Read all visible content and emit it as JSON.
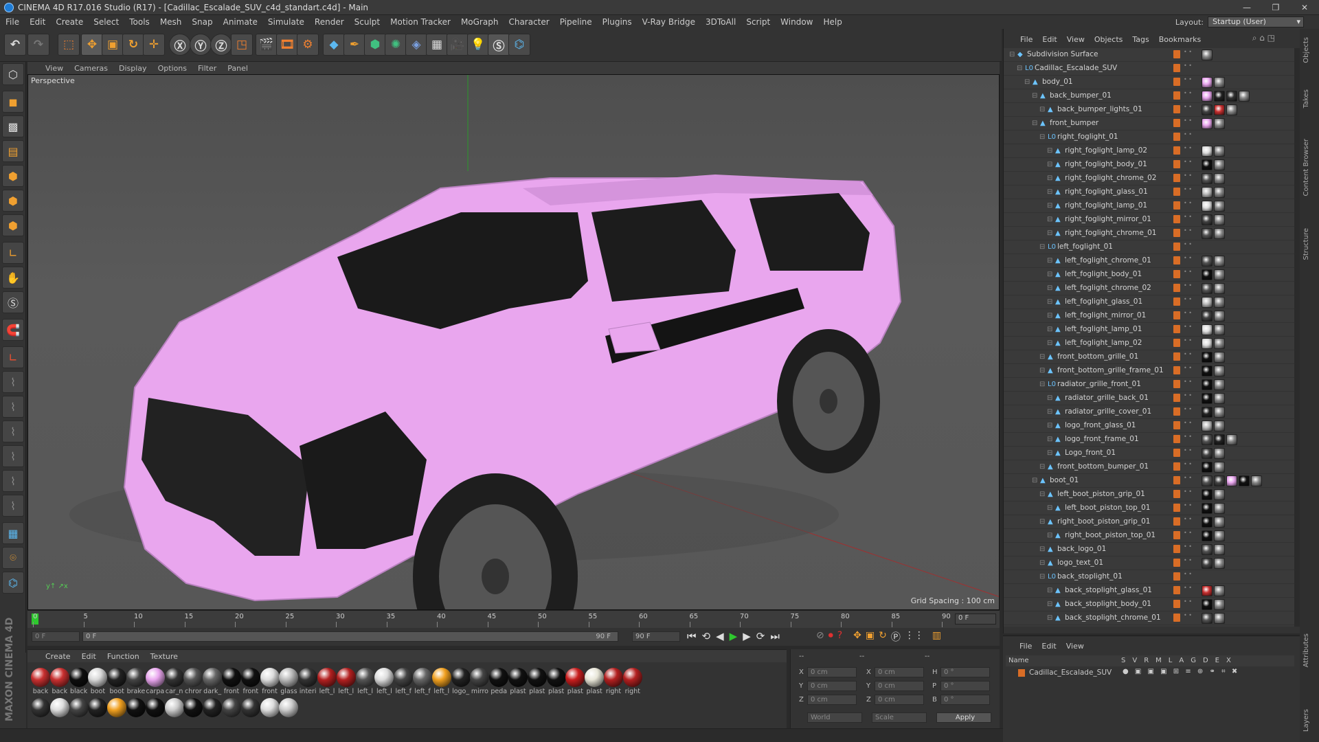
{
  "window": {
    "title": "CINEMA 4D R17.016 Studio (R17) - [Cadillac_Escalade_SUV_c4d_standart.c4d] - Main",
    "buttons": [
      "—",
      "❐",
      "✕"
    ]
  },
  "menu": [
    "File",
    "Edit",
    "Create",
    "Select",
    "Tools",
    "Mesh",
    "Snap",
    "Animate",
    "Simulate",
    "Render",
    "Sculpt",
    "Motion Tracker",
    "MoGraph",
    "Character",
    "Pipeline",
    "Plugins",
    "V-Ray Bridge",
    "3DToAll",
    "Script",
    "Window",
    "Help"
  ],
  "layout": {
    "label": "Layout:",
    "value": "Startup (User)"
  },
  "viewport": {
    "menu": [
      "View",
      "Cameras",
      "Display",
      "Options",
      "Filter",
      "Panel"
    ],
    "label": "Perspective",
    "grid_spacing": "Grid Spacing : 100 cm"
  },
  "timeline": {
    "ticks": [
      "0",
      "5",
      "10",
      "15",
      "20",
      "25",
      "30",
      "35",
      "40",
      "45",
      "50",
      "55",
      "60",
      "65",
      "70",
      "75",
      "80",
      "85",
      "90"
    ],
    "frame_field": "0 F",
    "start": "0 F",
    "start2": "0 F",
    "end": "90 F",
    "end2": "90 F"
  },
  "materials": {
    "menu": [
      "Create",
      "Edit",
      "Function",
      "Texture"
    ],
    "row1": [
      {
        "l": "back",
        "c": "#c83030"
      },
      {
        "l": "back",
        "c": "#c83030"
      },
      {
        "l": "black",
        "c": "#0e0e0e"
      },
      {
        "l": "boot",
        "c": "#d8d8d8"
      },
      {
        "l": "boot",
        "c": "#222"
      },
      {
        "l": "brake",
        "c": "#444"
      },
      {
        "l": "carpa",
        "c": "#e9a6ee"
      },
      {
        "l": "car_n",
        "c": "#333"
      },
      {
        "l": "chror",
        "c": "#555"
      },
      {
        "l": "dark_",
        "c": "#666"
      },
      {
        "l": "front",
        "c": "#111"
      },
      {
        "l": "front",
        "c": "#111"
      },
      {
        "l": "front",
        "c": "#ddd"
      },
      {
        "l": "glass",
        "c": "#bbb"
      },
      {
        "l": "interi",
        "c": "#333"
      },
      {
        "l": "left_l",
        "c": "#b32020"
      },
      {
        "l": "left_l",
        "c": "#b32020"
      },
      {
        "l": "left_l",
        "c": "#555"
      },
      {
        "l": "left_l",
        "c": "#ddd"
      },
      {
        "l": "left_f",
        "c": "#444"
      },
      {
        "l": "left_f",
        "c": "#666"
      },
      {
        "l": "left_l",
        "c": "#f0a020"
      },
      {
        "l": "logo_",
        "c": "#222"
      },
      {
        "l": "mirro",
        "c": "#444"
      },
      {
        "l": "peda",
        "c": "#111"
      },
      {
        "l": "plast",
        "c": "#111"
      },
      {
        "l": "plast",
        "c": "#111"
      },
      {
        "l": "plast",
        "c": "#111"
      },
      {
        "l": "plast",
        "c": "#c81e1e"
      },
      {
        "l": "plast",
        "c": "#e8e6d8"
      },
      {
        "l": "right",
        "c": "#b32020"
      },
      {
        "l": "right",
        "c": "#b32020"
      }
    ],
    "row2": [
      {
        "c": "#333"
      },
      {
        "c": "#ddd"
      },
      {
        "c": "#444"
      },
      {
        "c": "#222"
      },
      {
        "c": "#f0a020"
      },
      {
        "c": "#111"
      },
      {
        "c": "#111"
      },
      {
        "c": "#ccc"
      },
      {
        "c": "#111"
      },
      {
        "c": "#222"
      },
      {
        "c": "#444"
      },
      {
        "c": "#333"
      },
      {
        "c": "#ddd"
      },
      {
        "c": "#ccc"
      }
    ]
  },
  "coords": {
    "x": "X",
    "y": "Y",
    "z": "Z",
    "h": "H",
    "p": "P",
    "b": "B",
    "pos": "0 cm",
    "rot": "0 °",
    "world": "World",
    "scale": "Scale",
    "apply": "Apply",
    "dash": "--"
  },
  "objects": {
    "menu": [
      "File",
      "Edit",
      "View",
      "Objects",
      "Tags",
      "Bookmarks"
    ],
    "rows": [
      {
        "n": "Subdivision Surface",
        "d": 0,
        "i": "◆",
        "tags": [
          "#888"
        ]
      },
      {
        "n": "Cadillac_Escalade_SUV",
        "d": 1,
        "i": "L0",
        "tags": []
      },
      {
        "n": "body_01",
        "d": 2,
        "i": "▲",
        "tags": [
          "#e9a6ee",
          "#888"
        ]
      },
      {
        "n": "back_bumper_01",
        "d": 3,
        "i": "▲",
        "tags": [
          "#e9a6ee",
          "#222",
          "#333",
          "#888"
        ]
      },
      {
        "n": "back_bumper_lights_01",
        "d": 4,
        "i": "▲",
        "tags": [
          "#444",
          "#c83030",
          "#888"
        ]
      },
      {
        "n": "front_bumper",
        "d": 3,
        "i": "▲",
        "tags": [
          "#e9a6ee",
          "#888"
        ]
      },
      {
        "n": "right_foglight_01",
        "d": 4,
        "i": "L0",
        "tags": []
      },
      {
        "n": "right_foglight_lamp_02",
        "d": 5,
        "i": "▲",
        "tags": [
          "#ddd",
          "#888"
        ]
      },
      {
        "n": "right_foglight_body_01",
        "d": 5,
        "i": "▲",
        "tags": [
          "#111",
          "#888"
        ]
      },
      {
        "n": "right_foglight_chrome_02",
        "d": 5,
        "i": "▲",
        "tags": [
          "#555",
          "#888"
        ]
      },
      {
        "n": "right_foglight_glass_01",
        "d": 5,
        "i": "▲",
        "tags": [
          "#bbb",
          "#888"
        ]
      },
      {
        "n": "right_foglight_lamp_01",
        "d": 5,
        "i": "▲",
        "tags": [
          "#ddd",
          "#888"
        ]
      },
      {
        "n": "right_foglight_mirror_01",
        "d": 5,
        "i": "▲",
        "tags": [
          "#444",
          "#888"
        ]
      },
      {
        "n": "right_foglight_chrome_01",
        "d": 5,
        "i": "▲",
        "tags": [
          "#555",
          "#888"
        ]
      },
      {
        "n": "left_foglight_01",
        "d": 4,
        "i": "L0",
        "tags": []
      },
      {
        "n": "left_foglight_chrome_01",
        "d": 5,
        "i": "▲",
        "tags": [
          "#555",
          "#888"
        ]
      },
      {
        "n": "left_foglight_body_01",
        "d": 5,
        "i": "▲",
        "tags": [
          "#111",
          "#888"
        ]
      },
      {
        "n": "left_foglight_chrome_02",
        "d": 5,
        "i": "▲",
        "tags": [
          "#555",
          "#888"
        ]
      },
      {
        "n": "left_foglight_glass_01",
        "d": 5,
        "i": "▲",
        "tags": [
          "#bbb",
          "#888"
        ]
      },
      {
        "n": "left_foglight_mirror_01",
        "d": 5,
        "i": "▲",
        "tags": [
          "#444",
          "#888"
        ]
      },
      {
        "n": "left_foglight_lamp_01",
        "d": 5,
        "i": "▲",
        "tags": [
          "#ddd",
          "#888"
        ]
      },
      {
        "n": "left_foglight_lamp_02",
        "d": 5,
        "i": "▲",
        "tags": [
          "#ddd",
          "#888"
        ]
      },
      {
        "n": "front_bottom_grille_01",
        "d": 4,
        "i": "▲",
        "tags": [
          "#111",
          "#888"
        ]
      },
      {
        "n": "front_bottom_grille_frame_01",
        "d": 4,
        "i": "▲",
        "tags": [
          "#111",
          "#888"
        ]
      },
      {
        "n": "radiator_grille_front_01",
        "d": 4,
        "i": "L0",
        "tags": [
          "#111",
          "#888"
        ]
      },
      {
        "n": "radiator_grille_back_01",
        "d": 5,
        "i": "▲",
        "tags": [
          "#111",
          "#888"
        ]
      },
      {
        "n": "radiator_grille_cover_01",
        "d": 5,
        "i": "▲",
        "tags": [
          "#222",
          "#888"
        ]
      },
      {
        "n": "logo_front_glass_01",
        "d": 5,
        "i": "▲",
        "tags": [
          "#bbb",
          "#888"
        ]
      },
      {
        "n": "logo_front_frame_01",
        "d": 5,
        "i": "▲",
        "tags": [
          "#555",
          "#222",
          "#888"
        ]
      },
      {
        "n": "Logo_front_01",
        "d": 5,
        "i": "▲",
        "tags": [
          "#444",
          "#888"
        ]
      },
      {
        "n": "front_bottom_bumper_01",
        "d": 4,
        "i": "▲",
        "tags": [
          "#111",
          "#888"
        ]
      },
      {
        "n": "boot_01",
        "d": 3,
        "i": "▲",
        "tags": [
          "#555",
          "#444",
          "#e9a6ee",
          "#111",
          "#888"
        ]
      },
      {
        "n": "left_boot_piston_grip_01",
        "d": 4,
        "i": "▲",
        "tags": [
          "#111",
          "#888"
        ]
      },
      {
        "n": "left_boot_piston_top_01",
        "d": 5,
        "i": "▲",
        "tags": [
          "#111",
          "#888"
        ]
      },
      {
        "n": "right_boot_piston_grip_01",
        "d": 4,
        "i": "▲",
        "tags": [
          "#111",
          "#888"
        ]
      },
      {
        "n": "right_boot_piston_top_01",
        "d": 5,
        "i": "▲",
        "tags": [
          "#111",
          "#888"
        ]
      },
      {
        "n": "back_logo_01",
        "d": 4,
        "i": "▲",
        "tags": [
          "#555",
          "#888"
        ]
      },
      {
        "n": "logo_text_01",
        "d": 4,
        "i": "▲",
        "tags": [
          "#444",
          "#888"
        ]
      },
      {
        "n": "back_stoplight_01",
        "d": 4,
        "i": "L0",
        "tags": []
      },
      {
        "n": "back_stoplight_glass_01",
        "d": 5,
        "i": "▲",
        "tags": [
          "#c83030",
          "#888"
        ]
      },
      {
        "n": "back_stoplight_body_01",
        "d": 5,
        "i": "▲",
        "tags": [
          "#111",
          "#888"
        ]
      },
      {
        "n": "back_stoplight_chrome_01",
        "d": 5,
        "i": "▲",
        "tags": [
          "#555",
          "#888"
        ]
      }
    ]
  },
  "layers": {
    "menu": [
      "File",
      "Edit",
      "View"
    ],
    "name_col": "Name",
    "cols": [
      "S",
      "V",
      "R",
      "M",
      "L",
      "A",
      "G",
      "D",
      "E",
      "X"
    ],
    "item": "Cadillac_Escalade_SUV"
  },
  "right_tabs": [
    "Objects",
    "Takes",
    "Content Browser",
    "Structure",
    "Attributes",
    "Layers"
  ],
  "brand": "MAXON CINEMA 4D"
}
